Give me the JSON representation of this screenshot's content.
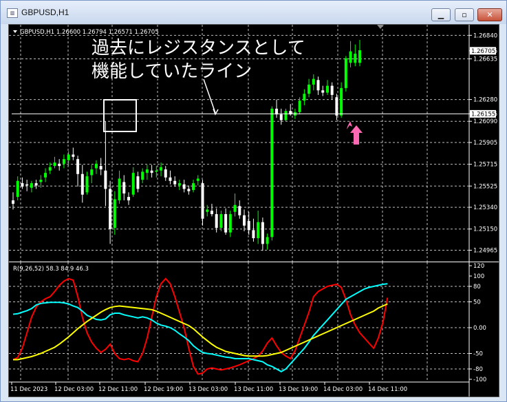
{
  "window": {
    "title": "GBPUSD,H1",
    "icon": "chart-window-icon",
    "minimize": "minimize-icon",
    "maximize": "maximize-icon",
    "close": "close-icon"
  },
  "colors": {
    "background": "#000000",
    "grid": "#bfbfbf",
    "bull_candle": "#00ff00",
    "bear_candle": "#ffffff",
    "axis_text": "#ffffff",
    "resistance_line": "#ffffff",
    "annotation_box": "#ffffff",
    "arrow": "#ff69b4",
    "indicator_red": "#ff0000",
    "indicator_cyan": "#00ffff",
    "indicator_yellow": "#ffff00"
  },
  "main": {
    "info": "GBPUSD,H1  1.26600 1.26794 1.26571 1.26705",
    "annotation_line1": "過去にレジスタンスとして",
    "annotation_line2": "機能していたライン",
    "price_ticks": [
      "1.26840",
      "1.26705",
      "1.26635",
      "1.26280",
      "1.26155",
      "1.26090",
      "1.25905",
      "1.25715",
      "1.25525",
      "1.25340",
      "1.25150",
      "1.24965"
    ],
    "current_price": "1.26705",
    "line_price": "1.26155"
  },
  "indicator": {
    "label": "R(9,26,52) 58.3 84.9 46.3",
    "ticks": [
      "120",
      "100",
      "80",
      "50",
      "0.00",
      "-50",
      "-80",
      "-100"
    ]
  },
  "time_axis": [
    "11 Dec 2023",
    "12 Dec 03:00",
    "12 Dec 11:00",
    "12 Dec 19:00",
    "13 Dec 03:00",
    "13 Dec 11:00",
    "13 Dec 19:00",
    "14 Dec 03:00",
    "14 Dec 11:00"
  ],
  "chart_data": {
    "type": "candlestick",
    "symbol": "GBPUSD",
    "timeframe": "H1",
    "ylim": [
      1.2489,
      1.2686
    ],
    "candles": [
      [
        1.254,
        1.2547,
        1.2532,
        1.2537
      ],
      [
        1.2543,
        1.2561,
        1.254,
        1.2557
      ],
      [
        1.2555,
        1.256,
        1.255,
        1.2552
      ],
      [
        1.2554,
        1.2558,
        1.2548,
        1.2553
      ],
      [
        1.2551,
        1.2557,
        1.2547,
        1.2555
      ],
      [
        1.2555,
        1.2558,
        1.255,
        1.2553
      ],
      [
        1.2556,
        1.2562,
        1.2551,
        1.2558
      ],
      [
        1.256,
        1.2568,
        1.2556,
        1.2564
      ],
      [
        1.2566,
        1.2573,
        1.2563,
        1.2569
      ],
      [
        1.257,
        1.2578,
        1.2568,
        1.2573
      ],
      [
        1.2572,
        1.2576,
        1.2566,
        1.257
      ],
      [
        1.2572,
        1.258,
        1.2568,
        1.2576
      ],
      [
        1.2575,
        1.2583,
        1.257,
        1.258
      ],
      [
        1.258,
        1.2586,
        1.2575,
        1.2578
      ],
      [
        1.2576,
        1.2579,
        1.2552,
        1.2563
      ],
      [
        1.2563,
        1.2571,
        1.2538,
        1.2545
      ],
      [
        1.2547,
        1.2565,
        1.2545,
        1.2561
      ],
      [
        1.2562,
        1.2571,
        1.2555,
        1.2567
      ],
      [
        1.2568,
        1.2575,
        1.2563,
        1.2572
      ],
      [
        1.257,
        1.2577,
        1.2562,
        1.2567
      ],
      [
        1.2566,
        1.2609,
        1.2535,
        1.255
      ],
      [
        1.255,
        1.2557,
        1.2502,
        1.2515
      ],
      [
        1.2516,
        1.2548,
        1.251,
        1.2541
      ],
      [
        1.254,
        1.2566,
        1.2537,
        1.2559
      ],
      [
        1.2556,
        1.2562,
        1.254,
        1.2546
      ],
      [
        1.2543,
        1.2547,
        1.2536,
        1.254
      ],
      [
        1.2545,
        1.2569,
        1.2543,
        1.2564
      ],
      [
        1.2561,
        1.2565,
        1.2547,
        1.255
      ],
      [
        1.2558,
        1.2568,
        1.2555,
        1.2565
      ],
      [
        1.2564,
        1.2571,
        1.2558,
        1.2567
      ],
      [
        1.2566,
        1.2571,
        1.256,
        1.2564
      ],
      [
        1.2565,
        1.257,
        1.256,
        1.2566
      ],
      [
        1.2566,
        1.2573,
        1.2561,
        1.2569
      ],
      [
        1.2567,
        1.257,
        1.2557,
        1.256
      ],
      [
        1.256,
        1.2566,
        1.2554,
        1.2557
      ],
      [
        1.2557,
        1.2561,
        1.2552,
        1.2554
      ],
      [
        1.2553,
        1.2558,
        1.2549,
        1.2555
      ],
      [
        1.2554,
        1.2558,
        1.2547,
        1.255
      ],
      [
        1.255,
        1.2553,
        1.2545,
        1.2548
      ],
      [
        1.2549,
        1.2558,
        1.2547,
        1.2555
      ],
      [
        1.2557,
        1.2562,
        1.2553,
        1.2559
      ],
      [
        1.2555,
        1.2558,
        1.2518,
        1.2524
      ],
      [
        1.253,
        1.2536,
        1.2526,
        1.2532
      ],
      [
        1.2531,
        1.2537,
        1.2526,
        1.2528
      ],
      [
        1.2528,
        1.2533,
        1.2512,
        1.2516
      ],
      [
        1.2516,
        1.2531,
        1.2513,
        1.2528
      ],
      [
        1.2528,
        1.2533,
        1.251,
        1.2512
      ],
      [
        1.2512,
        1.2531,
        1.2508,
        1.2528
      ],
      [
        1.253,
        1.2546,
        1.2526,
        1.2536
      ],
      [
        1.2535,
        1.254,
        1.2524,
        1.2527
      ],
      [
        1.2527,
        1.2532,
        1.2513,
        1.2518
      ],
      [
        1.2522,
        1.253,
        1.251,
        1.2514
      ],
      [
        1.2514,
        1.2524,
        1.2504,
        1.2507
      ],
      [
        1.2507,
        1.2531,
        1.2502,
        1.2521
      ],
      [
        1.2521,
        1.2525,
        1.2496,
        1.2502
      ],
      [
        1.2502,
        1.2511,
        1.2497,
        1.2508
      ],
      [
        1.2508,
        1.2622,
        1.2505,
        1.262
      ],
      [
        1.262,
        1.2628,
        1.2612,
        1.2615
      ],
      [
        1.2615,
        1.262,
        1.2606,
        1.261
      ],
      [
        1.261,
        1.262,
        1.2609,
        1.2618
      ],
      [
        1.2618,
        1.2624,
        1.2614,
        1.2615
      ],
      [
        1.2614,
        1.262,
        1.2611,
        1.2617
      ],
      [
        1.2617,
        1.263,
        1.2615,
        1.2627
      ],
      [
        1.2627,
        1.2637,
        1.2623,
        1.2633
      ],
      [
        1.2633,
        1.2646,
        1.263,
        1.2641
      ],
      [
        1.2641,
        1.265,
        1.2636,
        1.2646
      ],
      [
        1.2645,
        1.2648,
        1.2632,
        1.2636
      ],
      [
        1.2636,
        1.264,
        1.2631,
        1.2634
      ],
      [
        1.2634,
        1.2645,
        1.2632,
        1.264
      ],
      [
        1.264,
        1.2643,
        1.2628,
        1.2632
      ],
      [
        1.263,
        1.2633,
        1.261,
        1.2614
      ],
      [
        1.2614,
        1.2643,
        1.2612,
        1.2638
      ],
      [
        1.2638,
        1.2666,
        1.2635,
        1.2664
      ],
      [
        1.266,
        1.2679,
        1.2656,
        1.267
      ],
      [
        1.266,
        1.2676,
        1.2657,
        1.2668
      ],
      [
        1.266,
        1.268,
        1.2657,
        1.2671
      ]
    ],
    "resistance_line_price": 1.26155,
    "indicator": {
      "name": "R(9,26,52)",
      "ylim": [
        -100,
        120
      ],
      "levels": [
        80,
        50,
        0,
        -50,
        -80
      ],
      "series": [
        {
          "name": "R(9)",
          "color": "#ff0000",
          "values": [
            -62,
            -58,
            -40,
            -10,
            20,
            40,
            50,
            56,
            60,
            70,
            82,
            90,
            95,
            92,
            60,
            20,
            -10,
            -28,
            -40,
            -48,
            -42,
            -32,
            -50,
            -60,
            -62,
            -60,
            -64,
            -66,
            -50,
            -20,
            20,
            60,
            85,
            95,
            85,
            60,
            30,
            0,
            -40,
            -75,
            -90,
            -88,
            -80,
            -78,
            -80,
            -82,
            -80,
            -78,
            -75,
            -72,
            -68,
            -64,
            -60,
            -55,
            -45,
            -30,
            -20,
            -35,
            -48,
            -55,
            -60,
            -45,
            -20,
            5,
            30,
            60,
            70,
            75,
            80,
            82,
            84,
            78,
            55,
            25,
            5,
            -10,
            -20,
            -30,
            -40,
            -20,
            10,
            58
          ]
        },
        {
          "name": "R(26)",
          "color": "#00ffff",
          "values": [
            26,
            27,
            30,
            33,
            37,
            44,
            47,
            48,
            49,
            49,
            49,
            48,
            46,
            42,
            39,
            32,
            24,
            20,
            16,
            15,
            17,
            25,
            28,
            28,
            25,
            23,
            21,
            19,
            21,
            19,
            15,
            9,
            5,
            3,
            0,
            -5,
            -12,
            -18,
            -25,
            -35,
            -42,
            -48,
            -50,
            -51,
            -53,
            -55,
            -57,
            -58,
            -60,
            -60,
            -60,
            -60,
            -62,
            -64,
            -66,
            -72,
            -75,
            -80,
            -85,
            -80,
            -70,
            -60,
            -50,
            -40,
            -28,
            -15,
            -5,
            5,
            15,
            25,
            35,
            45,
            55,
            60,
            65,
            70,
            75,
            78,
            80,
            82,
            84,
            85
          ]
        },
        {
          "name": "R(52)",
          "color": "#ffff00",
          "values": [
            -62,
            -62,
            -60,
            -58,
            -56,
            -53,
            -50,
            -46,
            -42,
            -38,
            -32,
            -25,
            -18,
            -10,
            -2,
            5,
            12,
            18,
            24,
            30,
            35,
            39,
            41,
            42,
            41,
            40,
            39,
            38,
            37,
            36,
            35,
            32,
            28,
            24,
            20,
            16,
            12,
            8,
            4,
            -2,
            -10,
            -18,
            -25,
            -32,
            -38,
            -42,
            -46,
            -48,
            -50,
            -52,
            -54,
            -55,
            -55,
            -55,
            -55,
            -54,
            -52,
            -50,
            -48,
            -44,
            -40,
            -36,
            -32,
            -28,
            -24,
            -20,
            -16,
            -12,
            -8,
            -4,
            0,
            4,
            8,
            12,
            16,
            20,
            24,
            28,
            32,
            38,
            42,
            46
          ]
        }
      ]
    }
  }
}
